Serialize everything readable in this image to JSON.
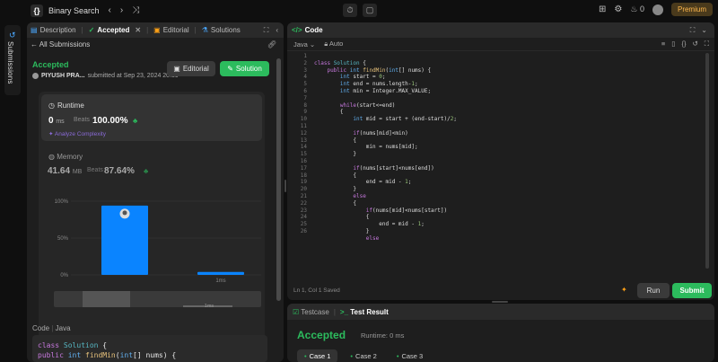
{
  "topbar": {
    "logo": "{}",
    "problem_title": "Binary Search",
    "streak_count": "0",
    "premium_label": "Premium"
  },
  "rail": {
    "label": "Submissions"
  },
  "left_tabs": {
    "description": "Description",
    "accepted": "Accepted",
    "editorial": "Editorial",
    "solutions": "Solutions"
  },
  "submission": {
    "back_label": "All Submissions",
    "status": "Accepted",
    "user": "PIYUSH PRA...",
    "submitted_text": "submitted at Sep 23, 2024 20:39",
    "editorial_btn": "Editorial",
    "solution_btn": "Solution",
    "runtime_label": "Runtime",
    "runtime_value": "0",
    "runtime_unit": "ms",
    "beats_label": "Beats",
    "runtime_beats": "100.00%",
    "analyze_label": "Analyze Complexity",
    "memory_label": "Memory",
    "memory_value": "41.64",
    "memory_unit": "MB",
    "memory_beats": "87.64%"
  },
  "chart_data": {
    "type": "bar",
    "categories": [
      "",
      "1ms"
    ],
    "values": [
      94,
      4
    ],
    "ytick_labels": [
      "100%",
      "50%",
      "0%"
    ],
    "ylim": [
      0,
      100
    ],
    "mini_label": "1ms",
    "colors": {
      "bar": "#0a84ff"
    }
  },
  "code_preview": {
    "label": "Code",
    "lang": "Java",
    "line1": "class Solution {",
    "line2": "    public int findMin(int[] nums) {"
  },
  "editor": {
    "tab": "Code",
    "language": "Java",
    "autocomplete": "Auto",
    "status": "Ln 1, Col 1",
    "saved": "Saved",
    "run_btn": "Run",
    "submit_btn": "Submit",
    "line_numbers": [
      "1",
      "2",
      "3",
      "4",
      "5",
      "6",
      "7",
      "8",
      "9",
      "10",
      "11",
      "12",
      "13",
      "14",
      "15",
      "16",
      "17",
      "18",
      "19",
      "20",
      "21",
      "22",
      "23",
      "24",
      "25",
      "26"
    ]
  },
  "result": {
    "testcase_tab": "Testcase",
    "result_tab": "Test Result",
    "status": "Accepted",
    "runtime": "Runtime: 0 ms",
    "cases": [
      "Case 1",
      "Case 2",
      "Case 3"
    ]
  }
}
